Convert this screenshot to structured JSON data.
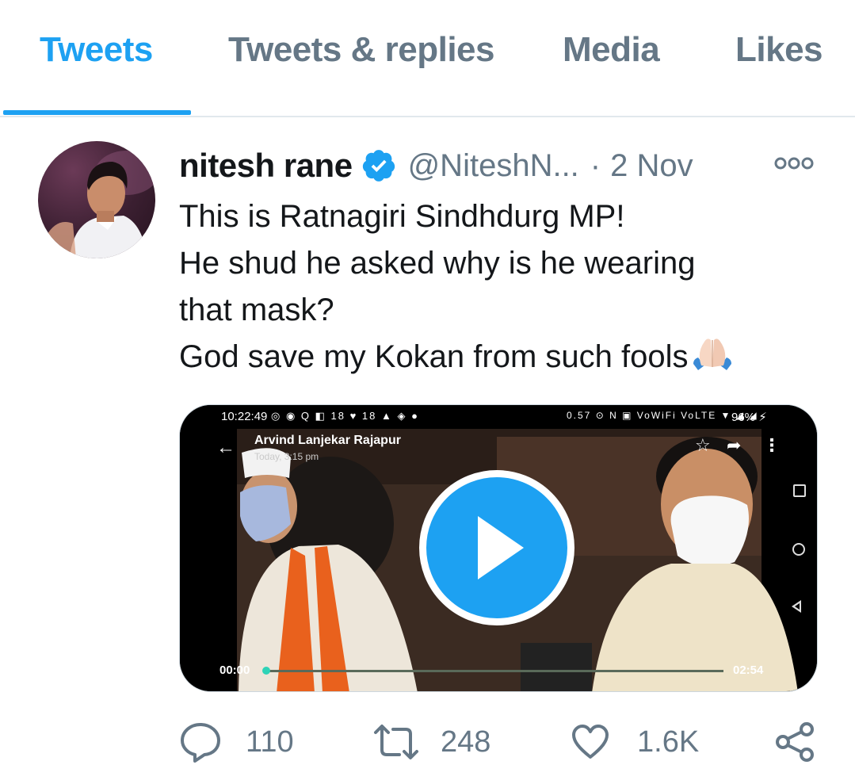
{
  "tabs": [
    {
      "label": "Tweets",
      "active": true
    },
    {
      "label": "Tweets & replies",
      "active": false
    },
    {
      "label": "Media",
      "active": false
    },
    {
      "label": "Likes",
      "active": false
    }
  ],
  "tweet": {
    "display_name": "nitesh rane",
    "verified": true,
    "handle": "@NiteshN...",
    "separator": "·",
    "date": "2 Nov",
    "text_lines": [
      "This is Ratnagiri Sindhdurg MP!",
      "He shud he asked why is he wearing",
      "that mask?",
      "God save my Kokan from such fools"
    ],
    "emoji": "folded-hands"
  },
  "video": {
    "status_time": "10:22:49",
    "status_left_icons": "◎ ◉ Q ◧ 18 ♥ 18 ▲ ◈ ●",
    "status_right_icons": "0.57 ⊙ N ▣ VoWiFi VoLTE ▼ ◢ ◢",
    "battery": "96% ⚡",
    "sender_name": "Arvind Lanjekar Rajapur",
    "sent_time": "Today, 3:15 pm",
    "elapsed": "00:00",
    "duration": "02:54",
    "progress": 0.0
  },
  "actions": {
    "replies": "110",
    "retweets": "248",
    "likes": "1.6K"
  },
  "colors": {
    "accent": "#1da1f2",
    "muted": "#657786",
    "text": "#14171a",
    "divider": "#e1e8ed"
  }
}
